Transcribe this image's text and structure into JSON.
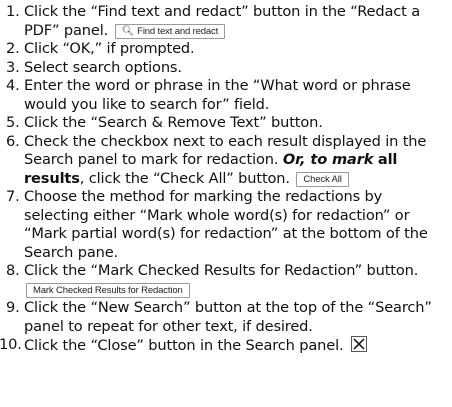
{
  "steps": [
    {
      "number": "1.",
      "text_before": "Click the “Find text and redact” button in the “Redact a PDF” panel.",
      "button_label": "Find text and redact"
    },
    {
      "number": "2.",
      "text": "Click “OK,” if prompted."
    },
    {
      "number": "3.",
      "text": "Select search options."
    },
    {
      "number": "4.",
      "text": "Enter the word or phrase in the “What word or phrase would you like to search for” field."
    },
    {
      "number": "5.",
      "text": "Click the “Search & Remove Text” button."
    },
    {
      "number": "6.",
      "text_before": "Check the checkbox next to each result displayed in the Search panel to mark for redaction.",
      "bold_italic": "Or, to mark",
      "bold": "all results",
      "text_after": ", click the “Check All” button.",
      "button_label": "Check All"
    },
    {
      "number": "7.",
      "text": "Choose the method for marking the redactions by selecting either “Mark whole word(s) for redaction” or “Mark partial word(s) for redaction” at the bottom of the Search pane."
    },
    {
      "number": "8.",
      "text_before": "Click the “Mark Checked Results for Redaction” button.",
      "button_label": "Mark Checked Results for Redaction"
    },
    {
      "number": "9.",
      "text": "Click the “New Search” button at the top of the “Search” panel to repeat for other text, if desired."
    },
    {
      "number": "10.",
      "text_before": "Click the “Close” button in the Search panel."
    }
  ],
  "icons": {
    "find_redact_icon": "find-redact-icon",
    "close_icon": "close-x-icon"
  }
}
